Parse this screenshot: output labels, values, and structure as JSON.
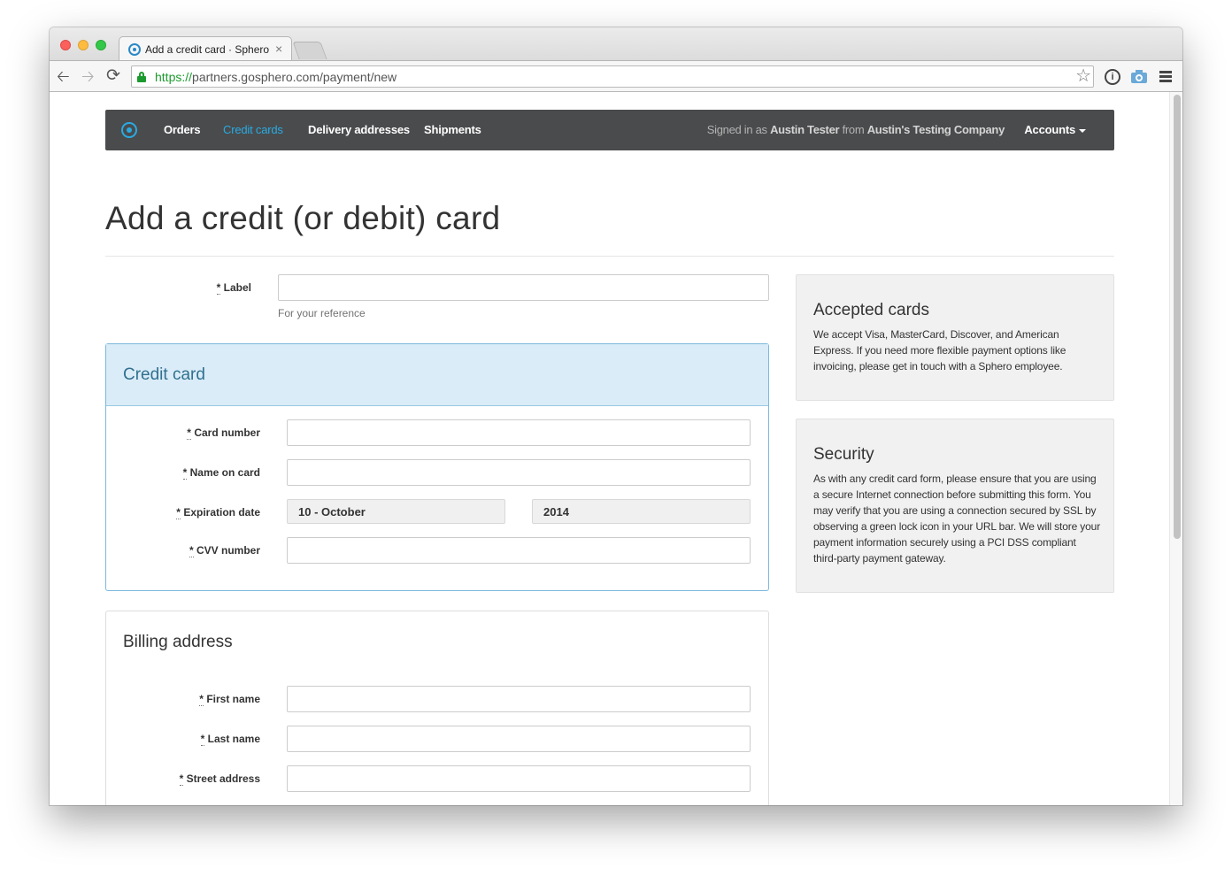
{
  "browser": {
    "tab_title": "Add a credit card · Sphero",
    "tab_close": "×",
    "url_scheme": "https://",
    "url_host": "partners.gosphero.com",
    "url_path": "/payment/new",
    "star": "☆",
    "info": "i"
  },
  "navbar": {
    "links": [
      {
        "label": "Orders"
      },
      {
        "label": "Credit cards",
        "active": true
      },
      {
        "label": "Delivery addresses"
      },
      {
        "label": "Shipments"
      }
    ],
    "signed_in_prefix": "Signed in as",
    "user_name": "Austin Tester",
    "signed_in_middle": "from",
    "company": "Austin's Testing Company",
    "accounts_label": "Accounts",
    "accent_color": "#29abe2"
  },
  "page": {
    "title": "Add a credit (or debit) card"
  },
  "form": {
    "required_mark": "*",
    "label_field": {
      "label": "Label",
      "help": "For your reference",
      "value": ""
    },
    "credit_card": {
      "heading": "Credit card",
      "card_number": {
        "label": "Card number",
        "value": ""
      },
      "name_on_card": {
        "label": "Name on card",
        "value": ""
      },
      "expiration": {
        "label": "Expiration date",
        "month": "10 - October",
        "year": "2014"
      },
      "cvv": {
        "label": "CVV number",
        "value": ""
      }
    },
    "billing": {
      "heading": "Billing address",
      "first_name": {
        "label": "First name",
        "value": ""
      },
      "last_name": {
        "label": "Last name",
        "value": ""
      },
      "street": {
        "label": "Street address",
        "value": ""
      }
    }
  },
  "sidebar": {
    "accepted": {
      "title": "Accepted cards",
      "body": "We accept Visa, MasterCard, Discover, and American Express. If you need more flexible payment options like invoicing, please get in touch with a Sphero employee."
    },
    "security": {
      "title": "Security",
      "body": "As with any credit card form, please ensure that you are using a secure Internet connection before submitting this form. You may verify that you are using a connection secured by SSL by observing a green lock icon in your URL bar. We will store your payment information securely using a PCI DSS compliant third-party payment gateway."
    }
  }
}
